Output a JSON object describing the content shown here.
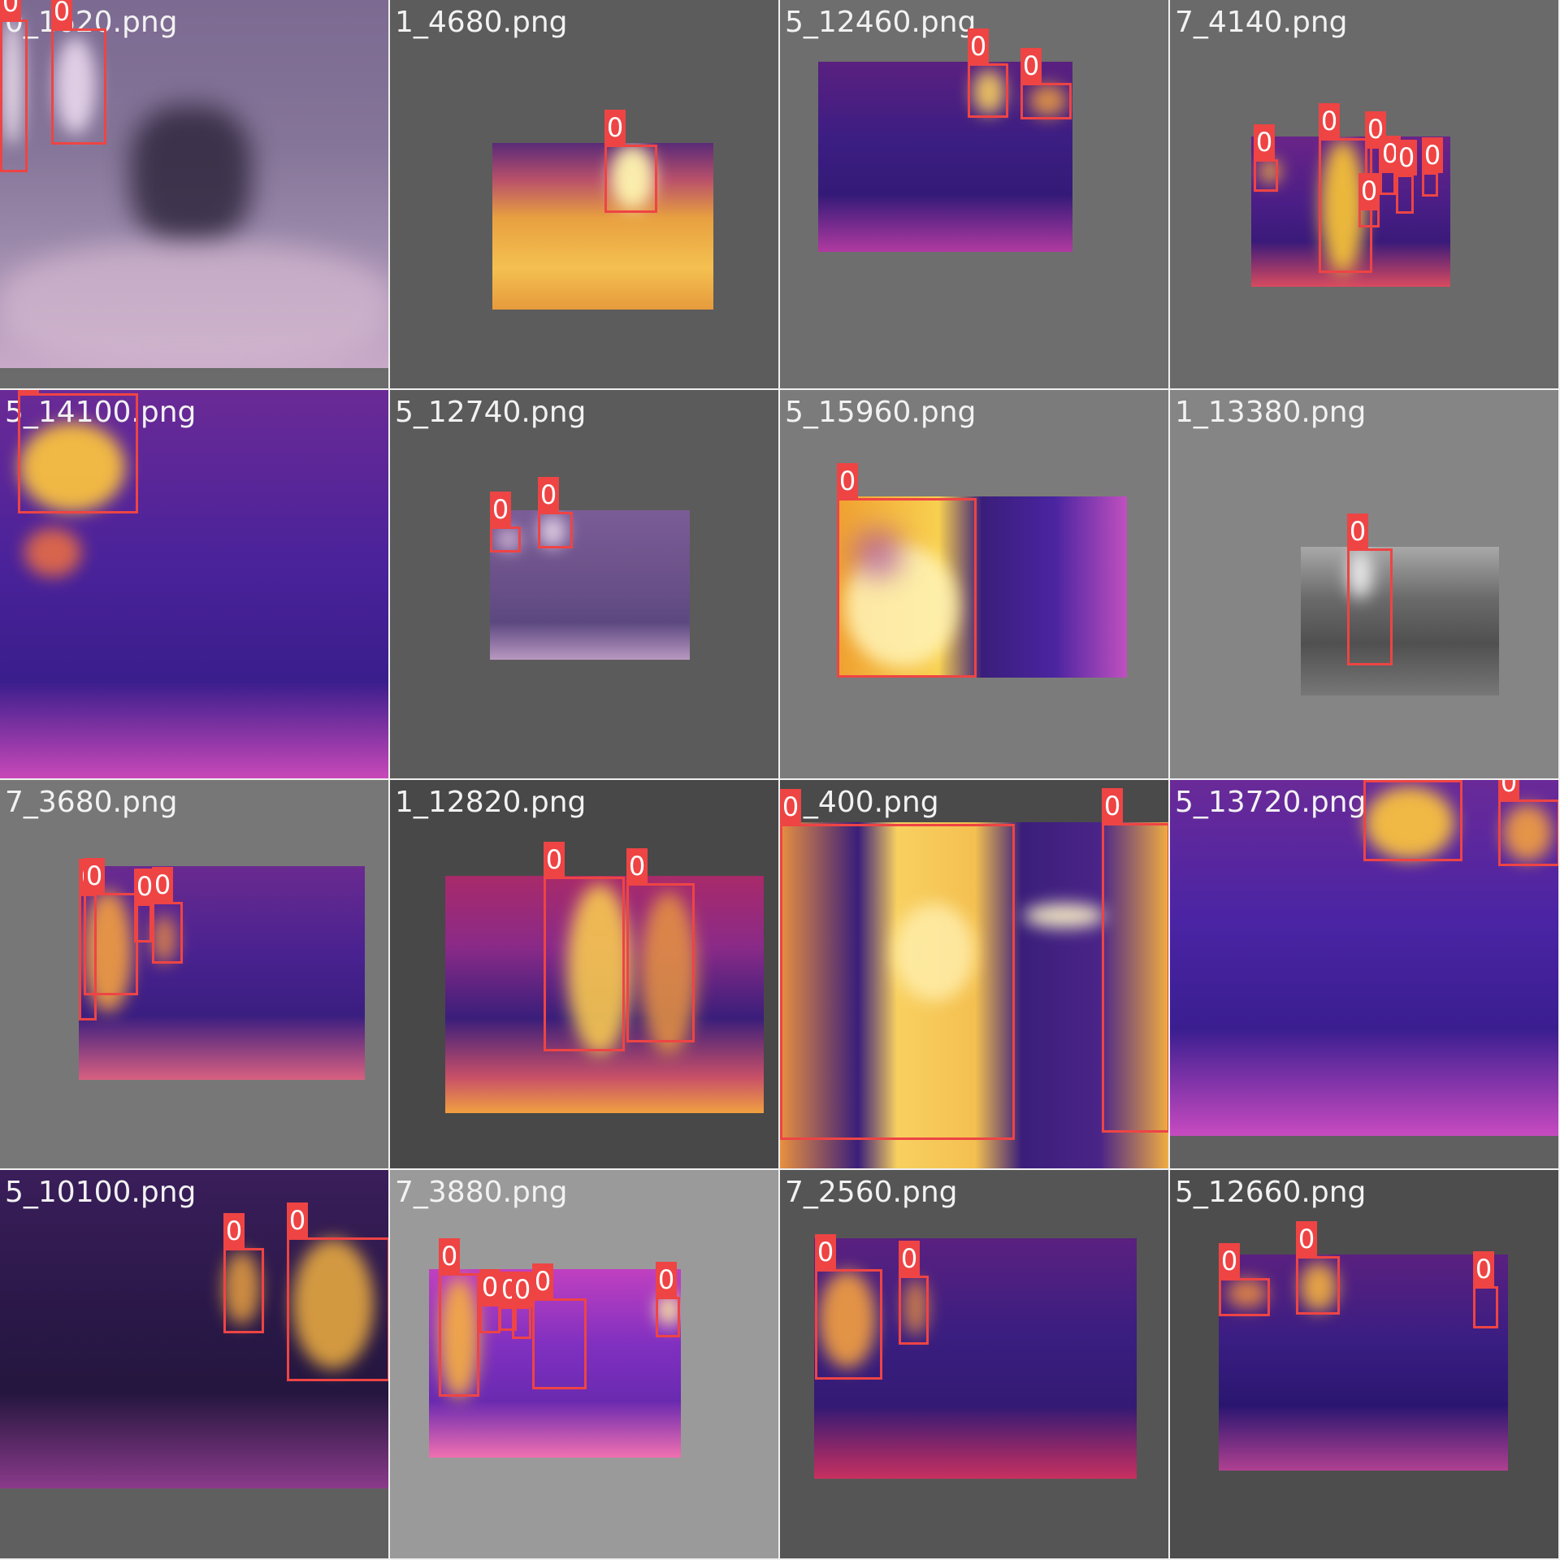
{
  "mosaic": {
    "class_label": "0",
    "box_color": "#ee4444",
    "tiles": [
      {
        "file": "0_1620.png",
        "bg": "#6b6b6b",
        "palette": "pale-lilac",
        "detections": 2
      },
      {
        "file": "1_4680.png",
        "bg": "#5c5c5c",
        "palette": "warm-yellow",
        "detections": 1
      },
      {
        "file": "5_12460.png",
        "bg": "#6e6e6e",
        "palette": "inferno",
        "detections": 2
      },
      {
        "file": "7_4140.png",
        "bg": "#6a6a6a",
        "palette": "inferno",
        "detections": 7
      },
      {
        "file": "5_14100.png",
        "bg": "#5a5a5a",
        "palette": "inferno",
        "detections": 1
      },
      {
        "file": "5_12740.png",
        "bg": "#5b5b5b",
        "palette": "faded-lilac",
        "detections": 2
      },
      {
        "file": "5_15960.png",
        "bg": "#7b7b7b",
        "palette": "inferno",
        "detections": 1
      },
      {
        "file": "1_13380.png",
        "bg": "#858585",
        "palette": "grayscale",
        "detections": 1
      },
      {
        "file": "7_3680.png",
        "bg": "#777777",
        "palette": "inferno",
        "detections": 4
      },
      {
        "file": "1_12820.png",
        "bg": "#484848",
        "palette": "warm-inferno",
        "detections": 2
      },
      {
        "file": "1_400.png",
        "bg": "#4a4a4a",
        "palette": "warm-inferno",
        "detections": 2
      },
      {
        "file": "5_13720.png",
        "bg": "#606060",
        "palette": "inferno",
        "detections": 2
      },
      {
        "file": "5_10100.png",
        "bg": "#5f5f5f",
        "palette": "dark-inferno",
        "detections": 2
      },
      {
        "file": "7_3880.png",
        "bg": "#9a9a9a",
        "palette": "magenta",
        "detections": 6
      },
      {
        "file": "7_2560.png",
        "bg": "#555555",
        "palette": "inferno",
        "detections": 2
      },
      {
        "file": "5_12660.png",
        "bg": "#4d4d4d",
        "palette": "inferno",
        "detections": 3
      }
    ]
  }
}
